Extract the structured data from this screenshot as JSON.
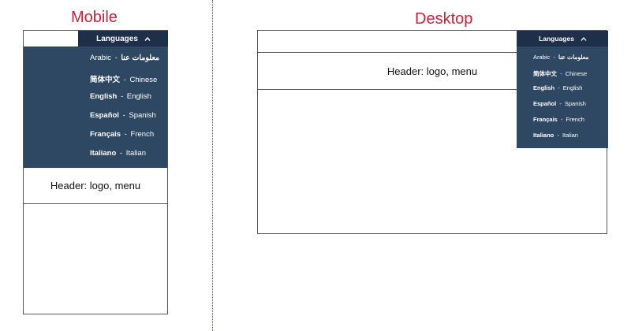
{
  "titles": {
    "mobile": "Mobile",
    "desktop": "Desktop"
  },
  "dropdown": {
    "label": "Languages",
    "items": [
      {
        "native": "Arabic",
        "native_weight": "normal",
        "separator": "-",
        "english": "معلومات عنا",
        "english_weight": "bold"
      },
      {
        "native": "简体中文",
        "native_weight": "bold",
        "separator": "-",
        "english": "Chinese",
        "english_weight": "normal"
      },
      {
        "native": "English",
        "native_weight": "bold",
        "separator": "-",
        "english": "English",
        "english_weight": "normal"
      },
      {
        "native": "Español",
        "native_weight": "bold",
        "separator": "-",
        "english": "Spanish",
        "english_weight": "normal"
      },
      {
        "native": "Français",
        "native_weight": "bold",
        "separator": "-",
        "english": "French",
        "english_weight": "normal"
      },
      {
        "native": "Italiano",
        "native_weight": "bold",
        "separator": "-",
        "english": "Italian",
        "english_weight": "normal"
      }
    ]
  },
  "header_label": "Header: logo, menu",
  "icons": {
    "dropdown_toggle": "chevron-up-icon"
  },
  "colors": {
    "title": "#c0253b",
    "dropdown_button": "#1e2f4a",
    "dropdown_panel": "#2e4763"
  }
}
